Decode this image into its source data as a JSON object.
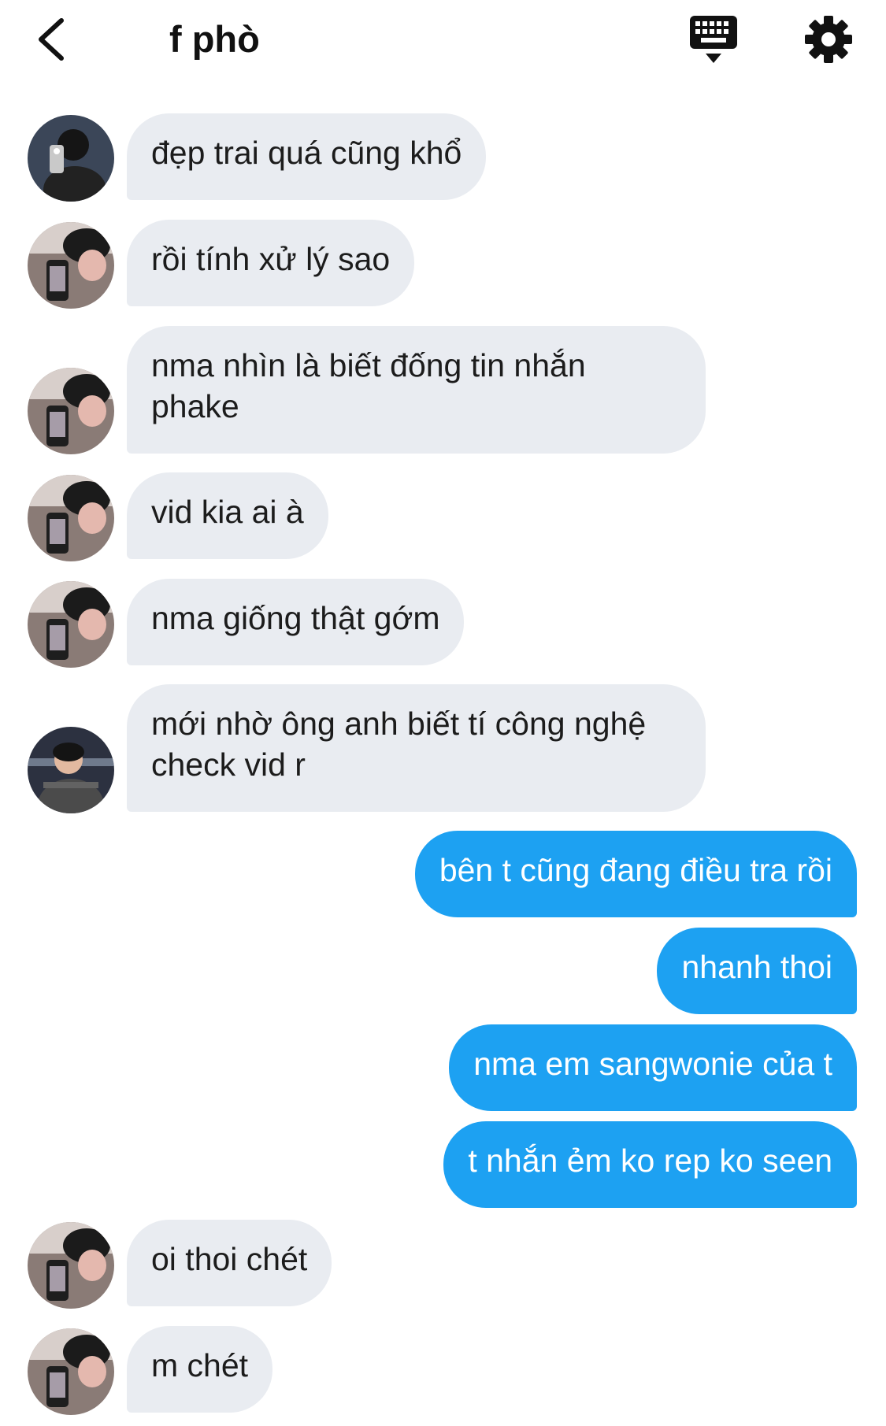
{
  "header": {
    "title": "f phò",
    "back_icon": "chevron-left-icon",
    "keyboard_icon": "keyboard-icon",
    "settings_icon": "gear-icon"
  },
  "colors": {
    "incoming_bubble": "#e9ecf1",
    "outgoing_bubble": "#1da1f2",
    "outgoing_text": "#ffffff"
  },
  "messages": [
    {
      "dir": "in",
      "text": "đẹp trai quá cũng khổ"
    },
    {
      "dir": "in",
      "text": "rồi tính xử lý sao"
    },
    {
      "dir": "in",
      "text": "nma nhìn là biết đống tin nhắn\nphake"
    },
    {
      "dir": "in",
      "text": "vid kia ai à"
    },
    {
      "dir": "in",
      "text": "nma giống thật gớm"
    },
    {
      "dir": "in",
      "text": "mới nhờ ông anh biết tí công nghệ\ncheck vid r"
    },
    {
      "dir": "out",
      "text": "bên t cũng đang điều tra rồi"
    },
    {
      "dir": "out",
      "text": "nhanh thoi"
    },
    {
      "dir": "out",
      "text": "nma em sangwonie của t"
    },
    {
      "dir": "out",
      "text": "t nhắn ẻm ko rep ko seen"
    },
    {
      "dir": "in",
      "text": "oi thoi chét"
    },
    {
      "dir": "in",
      "text": "m chét"
    }
  ]
}
